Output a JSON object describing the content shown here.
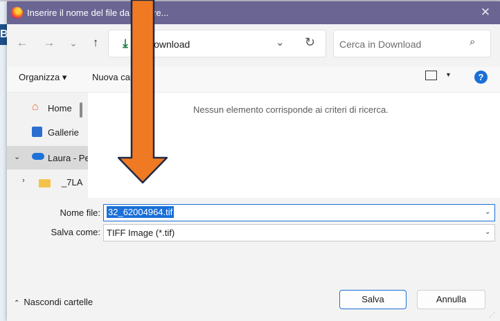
{
  "dialog": {
    "title": "Inserire il nome del file da salvare...",
    "close_label": "✕"
  },
  "address_bar": {
    "back_label": "←",
    "forward_label": "→",
    "history_label": "⌄",
    "up_label": "↑",
    "location": "Download",
    "refresh_label": "↻",
    "search_placeholder": "Cerca in Download"
  },
  "toolbar": {
    "organize_label": "Organizza ▾",
    "new_folder_label": "Nuova cartella",
    "help_label": "?"
  },
  "nav_pane": {
    "items": [
      {
        "label": "Home",
        "icon": "home-icon"
      },
      {
        "label": "Gallerie",
        "icon": "gallery-icon"
      },
      {
        "label": "Laura - Personale",
        "icon": "onedrive-icon",
        "expanded": true,
        "selected": true
      },
      {
        "label": "_7LA",
        "icon": "folder-icon",
        "expanded": false
      }
    ]
  },
  "content": {
    "empty_message": "Nessun elemento corrisponde ai criteri di ricerca."
  },
  "form": {
    "file_name_label": "Nome file:",
    "file_name_value": "32_62004964.tif",
    "save_as_label": "Salva come:",
    "save_as_value": "TIFF Image (*.tif)"
  },
  "footer": {
    "hide_folders_label": "Nascondi cartelle",
    "save_label": "Salva",
    "cancel_label": "Annulla"
  },
  "background_app": {
    "letter": "B"
  },
  "colors": {
    "titlebar": "#6b6593",
    "accent": "#1a6fd8",
    "arrow_fill": "#f07a23",
    "arrow_stroke": "#1f2a44"
  }
}
